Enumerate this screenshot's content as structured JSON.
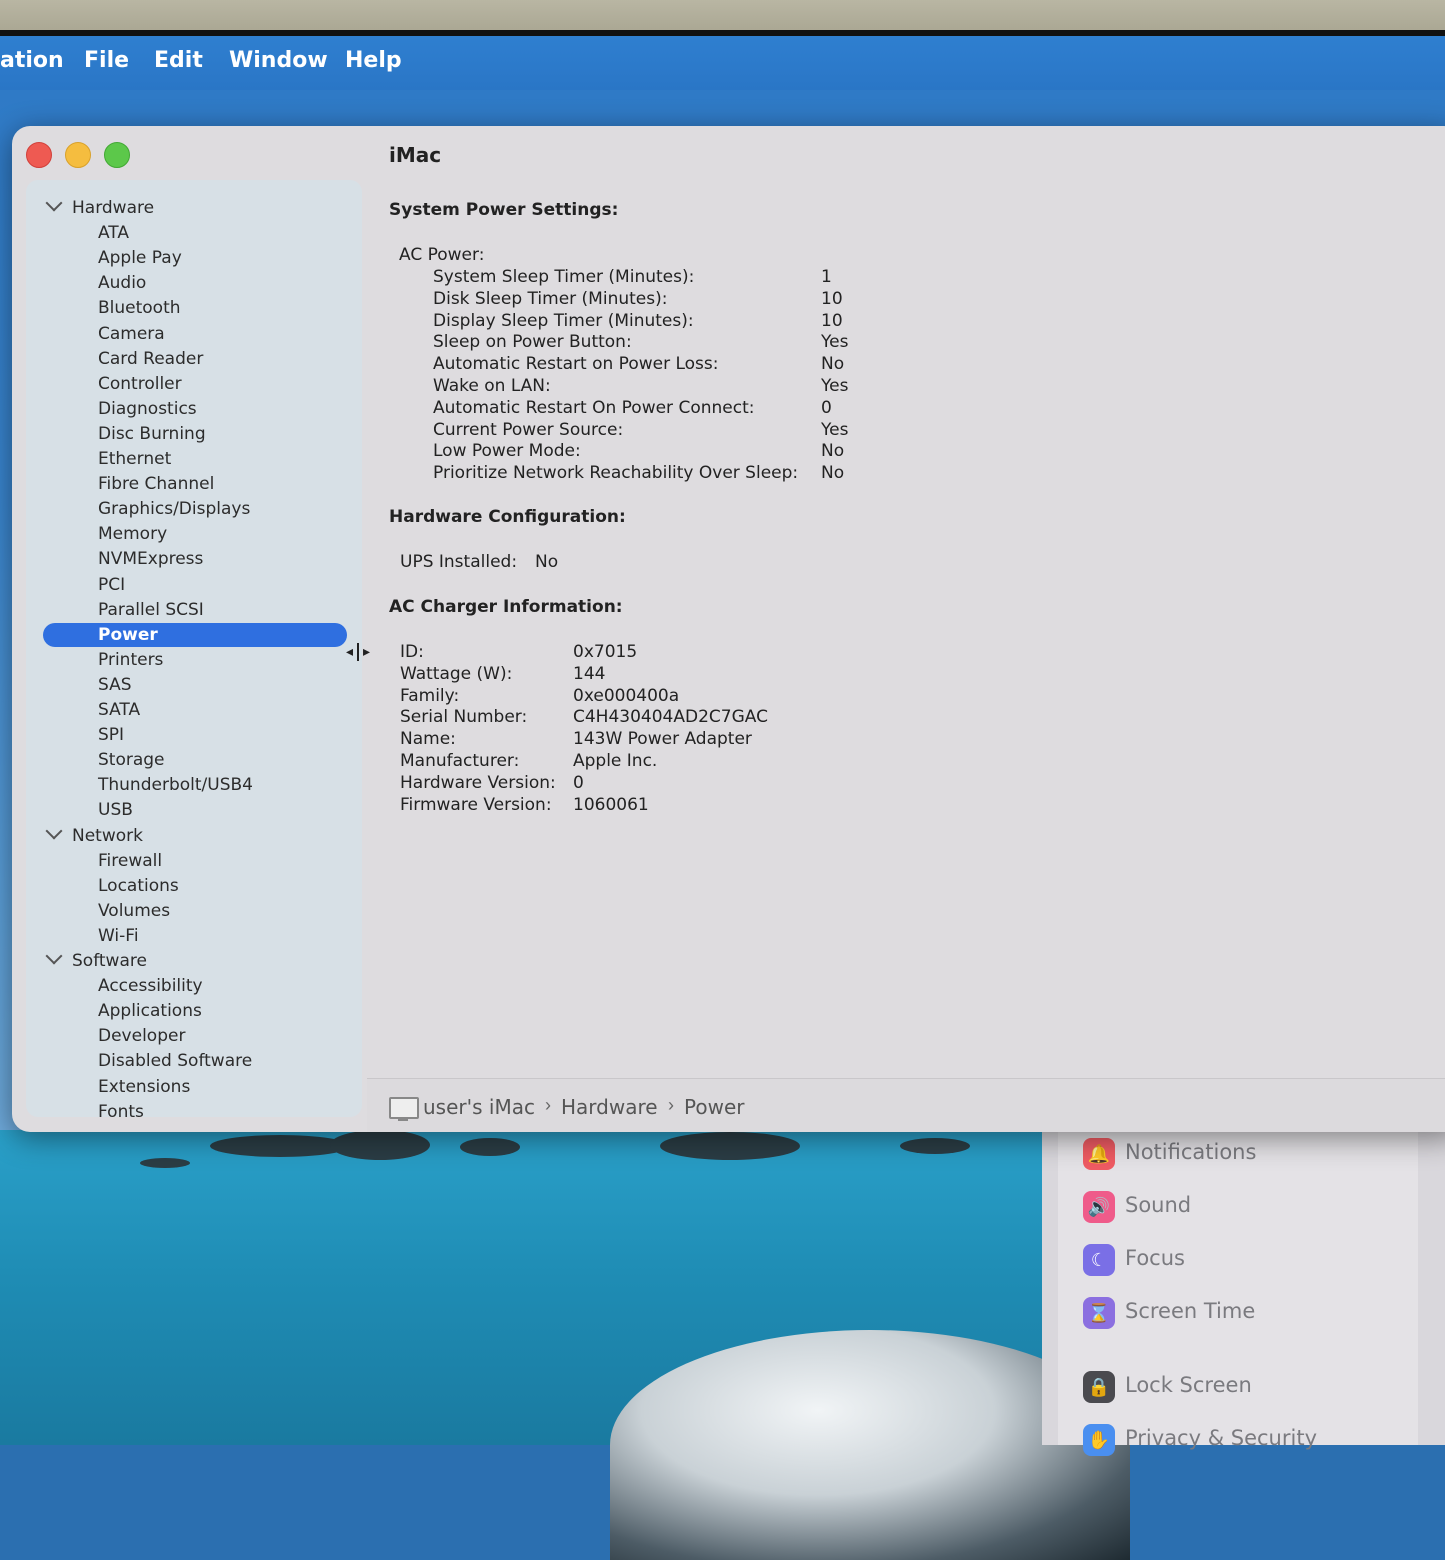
{
  "menubar": {
    "app_fragment": "ation",
    "items": [
      "File",
      "Edit",
      "Window",
      "Help"
    ]
  },
  "window": {
    "title": "iMac"
  },
  "sidebar": {
    "groups": [
      {
        "label": "Hardware",
        "items": [
          "ATA",
          "Apple Pay",
          "Audio",
          "Bluetooth",
          "Camera",
          "Card Reader",
          "Controller",
          "Diagnostics",
          "Disc Burning",
          "Ethernet",
          "Fibre Channel",
          "Graphics/Displays",
          "Memory",
          "NVMExpress",
          "PCI",
          "Parallel SCSI",
          "Power",
          "Printers",
          "SAS",
          "SATA",
          "SPI",
          "Storage",
          "Thunderbolt/USB4",
          "USB"
        ]
      },
      {
        "label": "Network",
        "items": [
          "Firewall",
          "Locations",
          "Volumes",
          "Wi-Fi"
        ]
      },
      {
        "label": "Software",
        "items": [
          "Accessibility",
          "Applications",
          "Developer",
          "Disabled Software",
          "Extensions",
          "Fonts"
        ]
      }
    ],
    "selected": "Power"
  },
  "content": {
    "system_power_heading": "System Power Settings:",
    "ac_power_label": "AC Power:",
    "ac_power_rows": [
      {
        "key": "System Sleep Timer (Minutes):",
        "value": "1"
      },
      {
        "key": "Disk Sleep Timer (Minutes):",
        "value": "10"
      },
      {
        "key": "Display Sleep Timer (Minutes):",
        "value": "10"
      },
      {
        "key": "Sleep on Power Button:",
        "value": "Yes"
      },
      {
        "key": "Automatic Restart on Power Loss:",
        "value": "No"
      },
      {
        "key": "Wake on LAN:",
        "value": "Yes"
      },
      {
        "key": "Automatic Restart On Power Connect:",
        "value": "0"
      },
      {
        "key": "Current Power Source:",
        "value": "Yes"
      },
      {
        "key": "Low Power Mode:",
        "value": "No"
      },
      {
        "key": "Prioritize Network Reachability Over Sleep:",
        "value": "No"
      }
    ],
    "hardware_config_heading": "Hardware Configuration:",
    "ups_label": "UPS Installed:",
    "ups_value": "No",
    "charger_heading": "AC Charger Information:",
    "charger_rows": [
      {
        "key": "ID:",
        "value": "0x7015"
      },
      {
        "key": "Wattage (W):",
        "value": "144"
      },
      {
        "key": "Family:",
        "value": "0xe000400a"
      },
      {
        "key": "Serial Number:",
        "value": "C4H430404AD2C7GAC"
      },
      {
        "key": "Name:",
        "value": "143W Power Adapter"
      },
      {
        "key": "Manufacturer:",
        "value": "Apple Inc."
      },
      {
        "key": "Hardware Version:",
        "value": "0"
      },
      {
        "key": "Firmware Version:",
        "value": "1060061"
      }
    ]
  },
  "pathbar": {
    "crumbs": [
      "user's iMac",
      "Hardware",
      "Power"
    ],
    "separator": "›"
  },
  "settings_panel": {
    "items": [
      {
        "label": "Notifications",
        "icon": "bell-icon",
        "color": "#ef5b63"
      },
      {
        "label": "Sound",
        "icon": "speaker-icon",
        "color": "#ef5b8a"
      },
      {
        "label": "Focus",
        "icon": "moon-icon",
        "color": "#7a6fe6"
      },
      {
        "label": "Screen Time",
        "icon": "hourglass-icon",
        "color": "#8b6fe0"
      },
      {
        "label": "Lock Screen",
        "icon": "lock-icon",
        "color": "#4a4a4f"
      },
      {
        "label": "Privacy & Security",
        "icon": "hand-icon",
        "color": "#4a8ff0"
      }
    ]
  }
}
